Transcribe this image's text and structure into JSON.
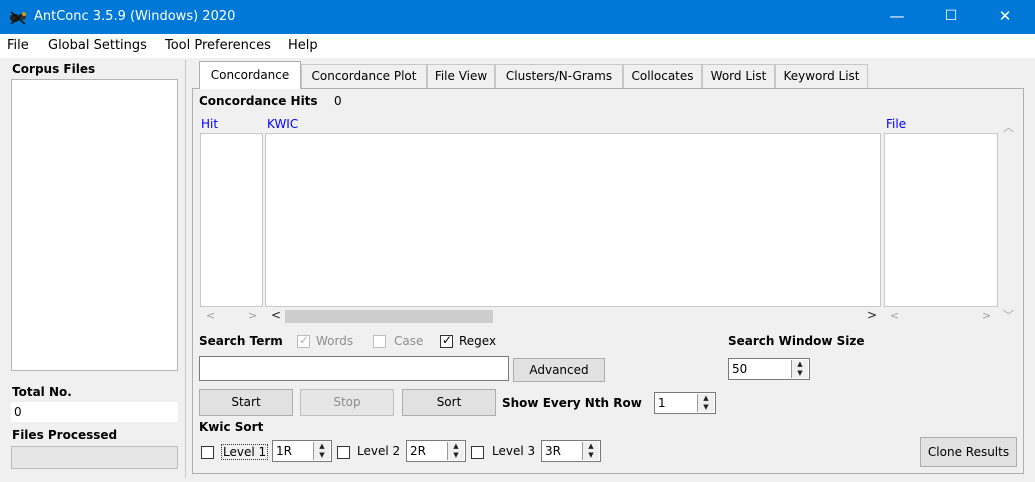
{
  "window": {
    "title": "AntConc 3.5.9 (Windows) 2020",
    "controls": {
      "minimize": "—",
      "maximize": "☐",
      "close": "✕"
    }
  },
  "menu": [
    "File",
    "Global Settings",
    "Tool Preferences",
    "Help"
  ],
  "sidebar": {
    "corpus_files_label": "Corpus Files",
    "total_no_label": "Total No.",
    "total_no_value": "0",
    "files_processed_label": "Files Processed"
  },
  "tabs": [
    "Concordance",
    "Concordance Plot",
    "File View",
    "Clusters/N-Grams",
    "Collocates",
    "Word List",
    "Keyword List"
  ],
  "concordance": {
    "hits_label": "Concordance Hits",
    "hits_value": "0",
    "columns": {
      "hit": "Hit",
      "kwic": "KWIC",
      "file": "File"
    }
  },
  "search": {
    "label": "Search Term",
    "options": [
      {
        "label": "Words",
        "checked": true,
        "enabled": false
      },
      {
        "label": "Case",
        "checked": false,
        "enabled": false
      },
      {
        "label": "Regex",
        "checked": true,
        "enabled": true
      }
    ],
    "term_value": "",
    "advanced_label": "Advanced",
    "window_size_label": "Search Window Size",
    "window_size_value": "50"
  },
  "actions": {
    "start": "Start",
    "stop": "Stop",
    "sort": "Sort"
  },
  "nth_row": {
    "label": "Show Every Nth Row",
    "value": "1"
  },
  "kwic_sort": {
    "label": "Kwic Sort",
    "levels": [
      {
        "label": "Level 1",
        "value": "1R",
        "checked": false
      },
      {
        "label": "Level 2",
        "value": "2R",
        "checked": false
      },
      {
        "label": "Level 3",
        "value": "3R",
        "checked": false
      }
    ]
  },
  "clone_results_label": "Clone Results",
  "colors": {
    "titlebar": "#0078d7",
    "column_header": "#0000ff"
  },
  "icons": {
    "app": "antconc-app-icon",
    "spin_up": "triangle-up",
    "spin_down": "triangle-down"
  }
}
